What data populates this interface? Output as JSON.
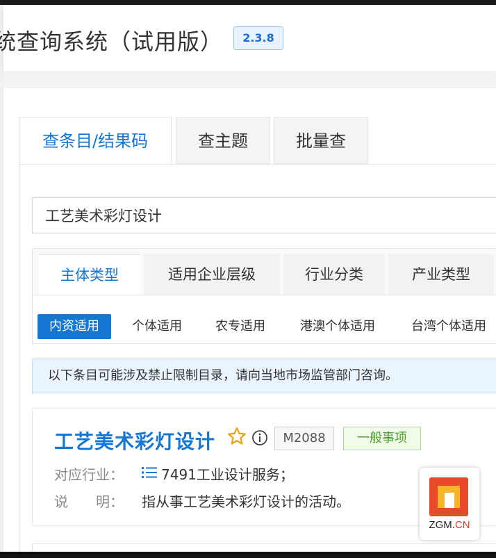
{
  "header": {
    "title": "统查询系统（试用版）",
    "version": "2.3.8"
  },
  "tabs": [
    {
      "label": "查条目/结果码",
      "active": true
    },
    {
      "label": "查主题",
      "active": false
    },
    {
      "label": "批量查",
      "active": false
    }
  ],
  "search": {
    "value": "工艺美术彩灯设计"
  },
  "subtabs": [
    {
      "label": "主体类型",
      "active": true
    },
    {
      "label": "适用企业层级",
      "active": false
    },
    {
      "label": "行业分类",
      "active": false
    },
    {
      "label": "产业类型",
      "active": false
    }
  ],
  "filters": [
    {
      "label": "内资适用",
      "active": true
    },
    {
      "label": "个体适用",
      "active": false
    },
    {
      "label": "农专适用",
      "active": false
    },
    {
      "label": "港澳个体适用",
      "active": false
    },
    {
      "label": "台湾个体适用",
      "active": false
    }
  ],
  "notice": "以下条目可能涉及禁止限制目录，请向当地市场监管部门咨询。",
  "result": {
    "title": "工艺美术彩灯设计",
    "code": "M2088",
    "type": "一般事项",
    "industry_label": "对应行业：",
    "industry_value": "7491工业设计服务；",
    "desc_label": "说　　明：",
    "desc_value": "指从事工艺美术彩灯设计的活动。",
    "icons": [
      "star-outline-icon",
      "info-icon",
      "list-icon"
    ]
  },
  "watermark": {
    "text_main": "ZGM.",
    "text_accent": "CN"
  },
  "colors": {
    "accent": "#1677d2",
    "tag_green": "#4aa22a",
    "notice_bg": "#e9f4ff"
  }
}
